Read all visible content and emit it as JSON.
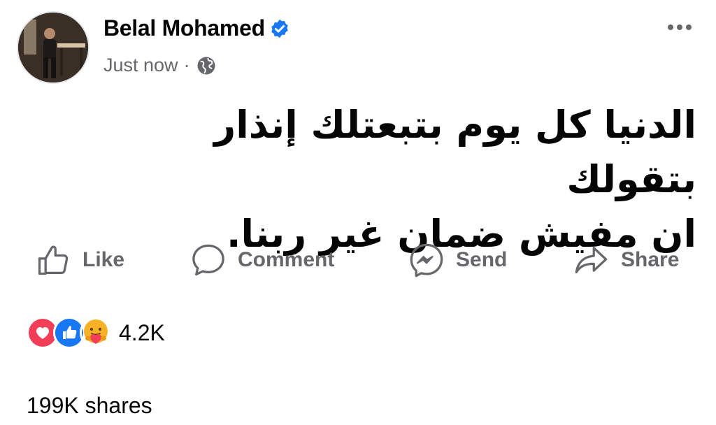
{
  "post": {
    "author": "Belal Mohamed",
    "timestamp": "Just now",
    "separator": "·",
    "text_line1": "الدنيا كل يوم بتبعتلك إنذار بتقولك",
    "text_line2": "ان مفيش ضمان غير ربنا."
  },
  "icons": {
    "verified": "verified-badge-icon",
    "audience": "globe-icon",
    "more": "more-options-icon"
  },
  "actions": {
    "like": "Like",
    "comment": "Comment",
    "send": "Send",
    "share": "Share"
  },
  "stats": {
    "reaction_count": "4.2K",
    "shares": "199K shares"
  },
  "colors": {
    "brand_blue": "#1877f2",
    "love_red": "#f33e58",
    "care_yellow": "#f7b125",
    "secondary_text": "#65676b"
  }
}
